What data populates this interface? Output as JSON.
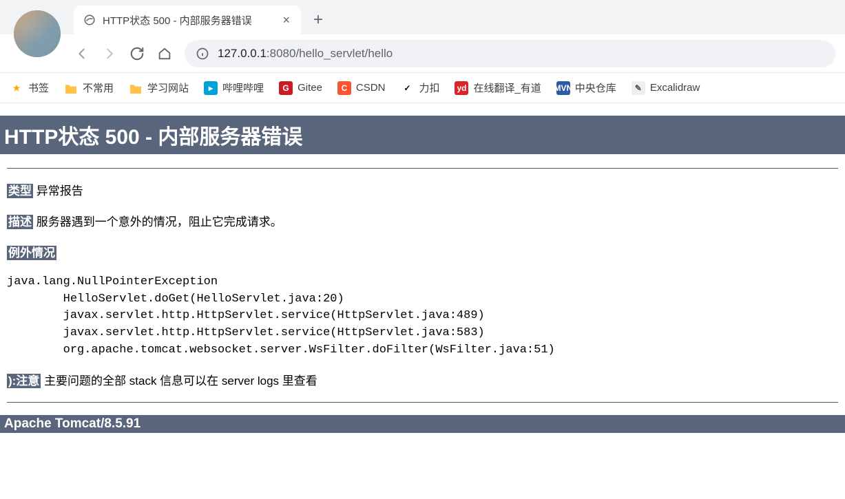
{
  "tab": {
    "title": "HTTP状态 500 - 内部服务器错误"
  },
  "address": {
    "host": "127.0.0.1",
    "port": ":8080",
    "path": "/hello_servlet/hello"
  },
  "bookmarks": [
    {
      "label": "书签",
      "icon": "star"
    },
    {
      "label": "不常用",
      "icon": "folder"
    },
    {
      "label": "学习网站",
      "icon": "folder"
    },
    {
      "label": "哔哩哔哩",
      "icon": "bilibili"
    },
    {
      "label": "Gitee",
      "icon": "gitee"
    },
    {
      "label": "CSDN",
      "icon": "csdn"
    },
    {
      "label": "力扣",
      "icon": "leetcode"
    },
    {
      "label": "在线翻译_有道",
      "icon": "youdao"
    },
    {
      "label": "中央仓库",
      "icon": "mvn"
    },
    {
      "label": "Excalidraw",
      "icon": "excalidraw"
    }
  ],
  "error": {
    "title": "HTTP状态 500 - 内部服务器错误",
    "type": {
      "label": "类型",
      "value": "异常报告"
    },
    "desc": {
      "label": "描述",
      "value": "服务器遇到一个意外的情况，阻止它完成请求。"
    },
    "exception": {
      "label": "例外情况"
    },
    "stacktrace": "java.lang.NullPointerException\n\tHelloServlet.doGet(HelloServlet.java:20)\n\tjavax.servlet.http.HttpServlet.service(HttpServlet.java:489)\n\tjavax.servlet.http.HttpServlet.service(HttpServlet.java:583)\n\torg.apache.tomcat.websocket.server.WsFilter.doFilter(WsFilter.java:51)",
    "note": {
      "label": "):注意",
      "value": "主要问题的全部 stack 信息可以在 server logs 里查看"
    },
    "footer": "Apache Tomcat/8.5.91"
  }
}
